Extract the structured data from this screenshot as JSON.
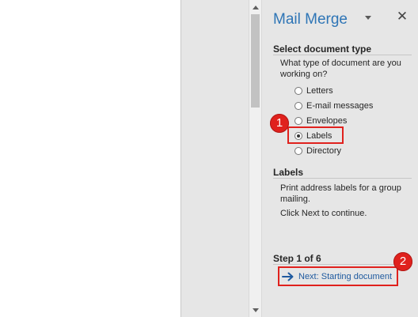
{
  "pane": {
    "title": "Mail Merge",
    "close_label": "✕",
    "section_select_type": "Select document type",
    "question": "What type of document are you working on?",
    "options": [
      {
        "label": "Letters",
        "checked": false
      },
      {
        "label": "E-mail messages",
        "checked": false
      },
      {
        "label": "Envelopes",
        "checked": false
      },
      {
        "label": "Labels",
        "checked": true
      },
      {
        "label": "Directory",
        "checked": false
      }
    ],
    "section_labels": "Labels",
    "labels_description": "Print address labels for a group mailing.",
    "continue_text": "Click Next to continue.",
    "step_text": "Step 1 of 6",
    "next_link": "Next: Starting document"
  },
  "callouts": [
    "1",
    "2"
  ],
  "colors": {
    "accent": "#2e75b6",
    "link": "#1f5a9f",
    "highlight": "#e0211d",
    "pane_bg": "#e6e6e6"
  }
}
